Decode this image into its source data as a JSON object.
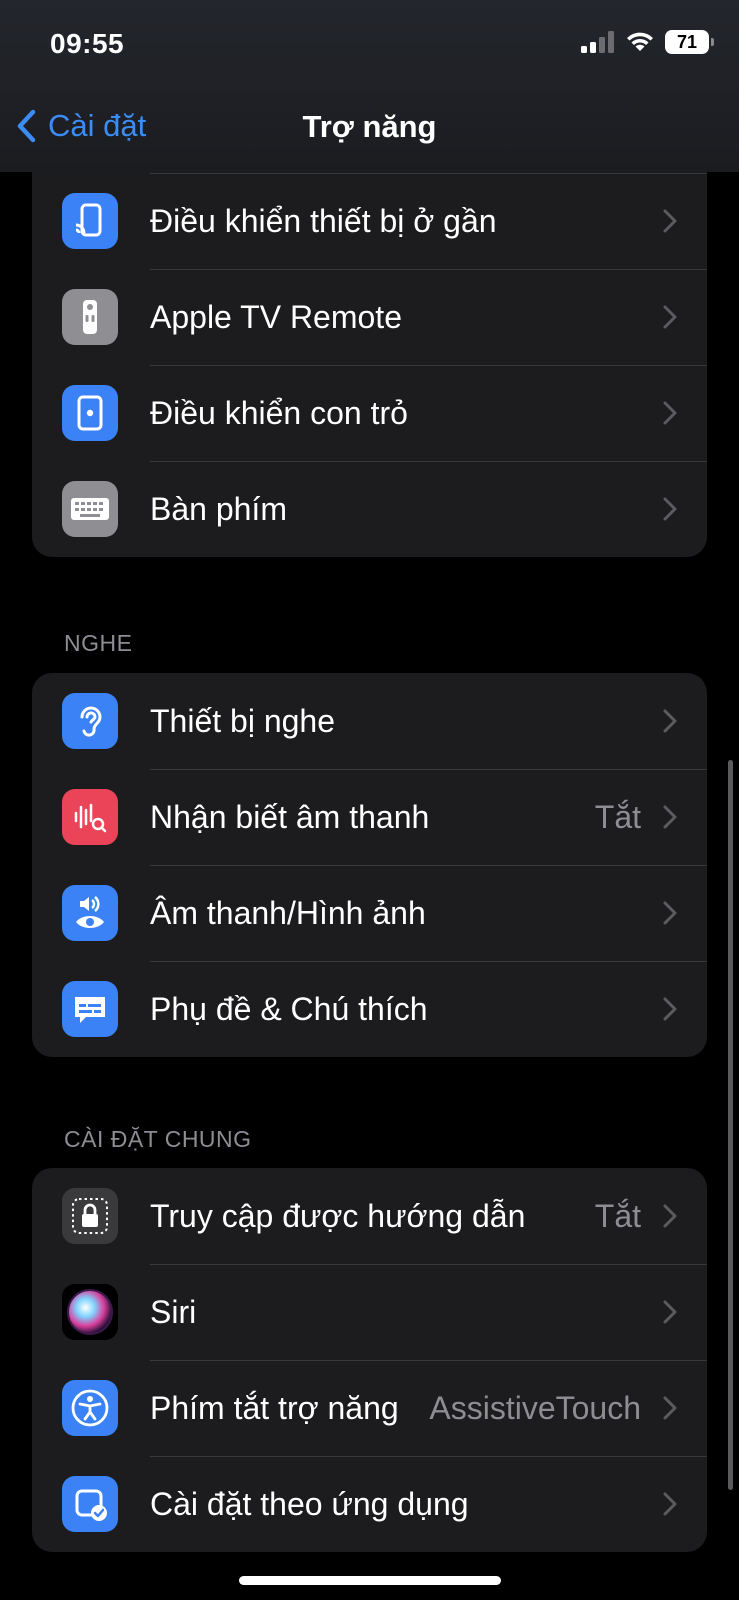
{
  "status_bar": {
    "time": "09:55",
    "battery": "71"
  },
  "nav": {
    "back_label": "Cài đặt",
    "title": "Trợ năng"
  },
  "top_group": {
    "items": [
      {
        "label": "Điều khiển thiết bị ở gần",
        "value": "",
        "icon": "nearby-device-icon"
      },
      {
        "label": "Apple TV Remote",
        "value": "",
        "icon": "tv-remote-icon"
      },
      {
        "label": "Điều khiển con trỏ",
        "value": "",
        "icon": "pointer-control-icon"
      },
      {
        "label": "Bàn phím",
        "value": "",
        "icon": "keyboard-icon"
      }
    ]
  },
  "hearing": {
    "header": "NGHE",
    "items": [
      {
        "label": "Thiết bị nghe",
        "value": "",
        "icon": "ear-icon"
      },
      {
        "label": "Nhận biết âm thanh",
        "value": "Tắt",
        "icon": "sound-recognition-icon"
      },
      {
        "label": "Âm thanh/Hình ảnh",
        "value": "",
        "icon": "audio-visual-icon"
      },
      {
        "label": "Phụ đề & Chú thích",
        "value": "",
        "icon": "subtitles-icon"
      }
    ]
  },
  "general": {
    "header": "CÀI ĐẶT CHUNG",
    "items": [
      {
        "label": "Truy cập được hướng dẫn",
        "value": "Tắt",
        "icon": "guided-access-lock-icon"
      },
      {
        "label": "Siri",
        "value": "",
        "icon": "siri-icon"
      },
      {
        "label": "Phím tắt trợ năng",
        "value": "AssistiveTouch",
        "icon": "accessibility-shortcut-icon"
      },
      {
        "label": "Cài đặt theo ứng dụng",
        "value": "",
        "icon": "per-app-settings-icon"
      }
    ]
  },
  "colors": {
    "background": "#000000",
    "cell": "#1c1c1e",
    "accent": "#3b8cf5",
    "secondary_text": "#8d8d93"
  }
}
